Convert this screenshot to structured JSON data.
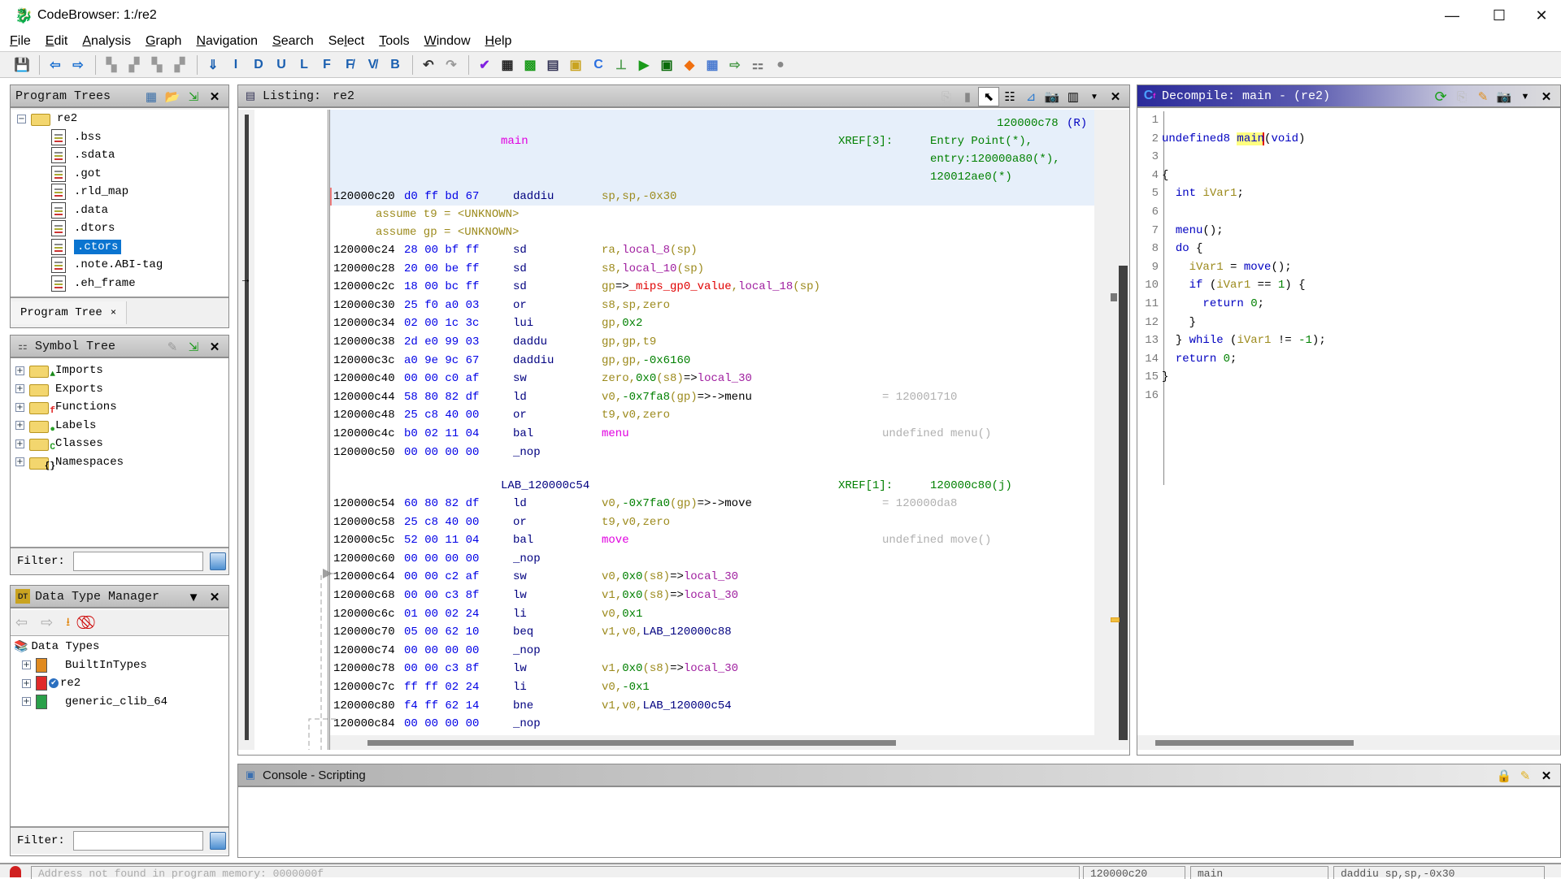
{
  "window": {
    "title": "CodeBrowser: 1:/re2",
    "controls": {
      "minimize": "—",
      "maximize": "☐",
      "close": "✕"
    }
  },
  "menu": [
    "File",
    "Edit",
    "Analysis",
    "Graph",
    "Navigation",
    "Search",
    "Select",
    "Tools",
    "Window",
    "Help"
  ],
  "menu_mnemonics": [
    "F",
    "E",
    "A",
    "G",
    "N",
    "S",
    "l",
    "T",
    "W",
    "H"
  ],
  "toolbar": {
    "icons": [
      "save-icon",
      "back-icon",
      "forward-icon",
      "next-selected-icon",
      "prev-selected-icon",
      "next-highlight-icon",
      "prev-highlight-icon",
      "next-code-unit-icon",
      "next-instruction-icon",
      "next-data-icon",
      "next-undefined-icon",
      "next-label-icon",
      "next-function-icon",
      "next-non-function-icon",
      "next-bookmark-icon",
      "next-different-value-icon",
      "undo-icon",
      "redo-icon",
      "check-icon",
      "bytes-icon",
      "memory-map-icon",
      "listing-icon",
      "data-type-manager-icon",
      "decompiler-icon",
      "function-graph-icon",
      "run-script-icon",
      "register-icon",
      "bookmark-icon",
      "table-icon",
      "export-icon",
      "symbol-tree-icon",
      "debugger-icon"
    ]
  },
  "program_trees": {
    "title": "Program Trees",
    "root": "re2",
    "items": [
      ".bss",
      ".sdata",
      ".got",
      ".rld_map",
      ".data",
      ".dtors",
      ".ctors",
      ".note.ABI-tag",
      ".eh_frame"
    ],
    "selected": ".ctors",
    "tab_label": "Program Tree",
    "tab_close": "×"
  },
  "symbol_tree": {
    "title": "Symbol Tree",
    "items": [
      "Imports",
      "Exports",
      "Functions",
      "Labels",
      "Classes",
      "Namespaces"
    ],
    "filter_label": "Filter:",
    "filter_value": ""
  },
  "data_type_manager": {
    "title": "Data Type Manager",
    "root": "Data Types",
    "items": [
      "BuiltInTypes",
      "re2",
      "generic_clib_64"
    ],
    "filter_label": "Filter:",
    "filter_value": ""
  },
  "listing": {
    "title": "Listing:",
    "program": "re2",
    "function_label": "main",
    "xref_label": "XREF[3]:",
    "xref_top": "120000c78",
    "xref_top_suffix": "(R)",
    "xrefs": [
      "Entry Point(*),",
      "entry:120000a80(*),",
      "120012ae0(*)"
    ],
    "first": {
      "addr": "120000c20",
      "bytes": "d0 ff bd 67",
      "mnemonic": "daddiu",
      "operands": "sp,sp,-0x30"
    },
    "assumes": [
      "assume t9 = <UNKNOWN>",
      "assume gp = <UNKNOWN>"
    ],
    "rows1": [
      {
        "addr": "120000c24",
        "bytes": "28 00 bf ff",
        "mnemonic": "sd",
        "operands": "ra,local_8(sp)",
        "comment": ""
      },
      {
        "addr": "120000c28",
        "bytes": "20 00 be ff",
        "mnemonic": "sd",
        "operands": "s8,local_10(sp)",
        "comment": ""
      },
      {
        "addr": "120000c2c",
        "bytes": "18 00 bc ff",
        "mnemonic": "sd",
        "operands": "gp=>_mips_gp0_value,local_18(sp)",
        "comment": ""
      },
      {
        "addr": "120000c30",
        "bytes": "25 f0 a0 03",
        "mnemonic": "or",
        "operands": "s8,sp,zero",
        "comment": ""
      },
      {
        "addr": "120000c34",
        "bytes": "02 00 1c 3c",
        "mnemonic": "lui",
        "operands": "gp,0x2",
        "comment": ""
      },
      {
        "addr": "120000c38",
        "bytes": "2d e0 99 03",
        "mnemonic": "daddu",
        "operands": "gp,gp,t9",
        "comment": ""
      },
      {
        "addr": "120000c3c",
        "bytes": "a0 9e 9c 67",
        "mnemonic": "daddiu",
        "operands": "gp,gp,-0x6160",
        "comment": ""
      },
      {
        "addr": "120000c40",
        "bytes": "00 00 c0 af",
        "mnemonic": "sw",
        "operands": "zero,0x0(s8)=>local_30",
        "comment": ""
      },
      {
        "addr": "120000c44",
        "bytes": "58 80 82 df",
        "mnemonic": "ld",
        "operands": "v0,-0x7fa8(gp)=>->menu",
        "comment": "= 120001710"
      },
      {
        "addr": "120000c48",
        "bytes": "25 c8 40 00",
        "mnemonic": "or",
        "operands": "t9,v0,zero",
        "comment": ""
      },
      {
        "addr": "120000c4c",
        "bytes": "b0 02 11 04",
        "mnemonic": "bal",
        "operands": "menu",
        "comment": "undefined menu()"
      },
      {
        "addr": "120000c50",
        "bytes": "00 00 00 00",
        "mnemonic": "_nop",
        "operands": "",
        "comment": ""
      }
    ],
    "label2": "LAB_120000c54",
    "xref2_label": "XREF[1]:",
    "xref2": "120000c80(j)",
    "rows2": [
      {
        "addr": "120000c54",
        "bytes": "60 80 82 df",
        "mnemonic": "ld",
        "operands": "v0,-0x7fa0(gp)=>->move",
        "comment": "= 120000da8"
      },
      {
        "addr": "120000c58",
        "bytes": "25 c8 40 00",
        "mnemonic": "or",
        "operands": "t9,v0,zero",
        "comment": ""
      },
      {
        "addr": "120000c5c",
        "bytes": "52 00 11 04",
        "mnemonic": "bal",
        "operands": "move",
        "comment": "undefined move()"
      },
      {
        "addr": "120000c60",
        "bytes": "00 00 00 00",
        "mnemonic": "_nop",
        "operands": "",
        "comment": ""
      },
      {
        "addr": "120000c64",
        "bytes": "00 00 c2 af",
        "mnemonic": "sw",
        "operands": "v0,0x0(s8)=>local_30",
        "comment": ""
      },
      {
        "addr": "120000c68",
        "bytes": "00 00 c3 8f",
        "mnemonic": "lw",
        "operands": "v1,0x0(s8)=>local_30",
        "comment": ""
      },
      {
        "addr": "120000c6c",
        "bytes": "01 00 02 24",
        "mnemonic": "li",
        "operands": "v0,0x1",
        "comment": ""
      },
      {
        "addr": "120000c70",
        "bytes": "05 00 62 10",
        "mnemonic": "beq",
        "operands": "v1,v0,LAB_120000c88",
        "comment": ""
      },
      {
        "addr": "120000c74",
        "bytes": "00 00 00 00",
        "mnemonic": "_nop",
        "operands": "",
        "comment": ""
      },
      {
        "addr": "120000c78",
        "bytes": "00 00 c3 8f",
        "mnemonic": "lw",
        "operands": "v1,0x0(s8)=>local_30",
        "comment": ""
      },
      {
        "addr": "120000c7c",
        "bytes": "ff ff 02 24",
        "mnemonic": "li",
        "operands": "v0,-0x1",
        "comment": ""
      },
      {
        "addr": "120000c80",
        "bytes": "f4 ff 62 14",
        "mnemonic": "bne",
        "operands": "v1,v0,LAB_120000c54",
        "comment": ""
      },
      {
        "addr": "120000c84",
        "bytes": "00 00 00 00",
        "mnemonic": "_nop",
        "operands": "",
        "comment": ""
      }
    ]
  },
  "decompiler": {
    "title": "Decompile: main -  (re2)",
    "lines": [
      {
        "n": "1",
        "code": ""
      },
      {
        "n": "2",
        "code": "undefined8 main(void)"
      },
      {
        "n": "3",
        "code": ""
      },
      {
        "n": "4",
        "code": "{"
      },
      {
        "n": "5",
        "code": "  int iVar1;"
      },
      {
        "n": "6",
        "code": ""
      },
      {
        "n": "7",
        "code": "  menu();"
      },
      {
        "n": "8",
        "code": "  do {"
      },
      {
        "n": "9",
        "code": "    iVar1 = move();"
      },
      {
        "n": "10",
        "code": "    if (iVar1 == 1) {"
      },
      {
        "n": "11",
        "code": "      return 0;"
      },
      {
        "n": "12",
        "code": "    }"
      },
      {
        "n": "13",
        "code": "  } while (iVar1 != -1);"
      },
      {
        "n": "14",
        "code": "  return 0;"
      },
      {
        "n": "15",
        "code": "}"
      },
      {
        "n": "16",
        "code": ""
      }
    ]
  },
  "console": {
    "title": "Console - Scripting"
  },
  "statusbar": {
    "message": "Address not found in program memory: 0000000f",
    "address": "120000c20",
    "function": "main",
    "instruction": "daddiu sp,sp,-0x30"
  }
}
